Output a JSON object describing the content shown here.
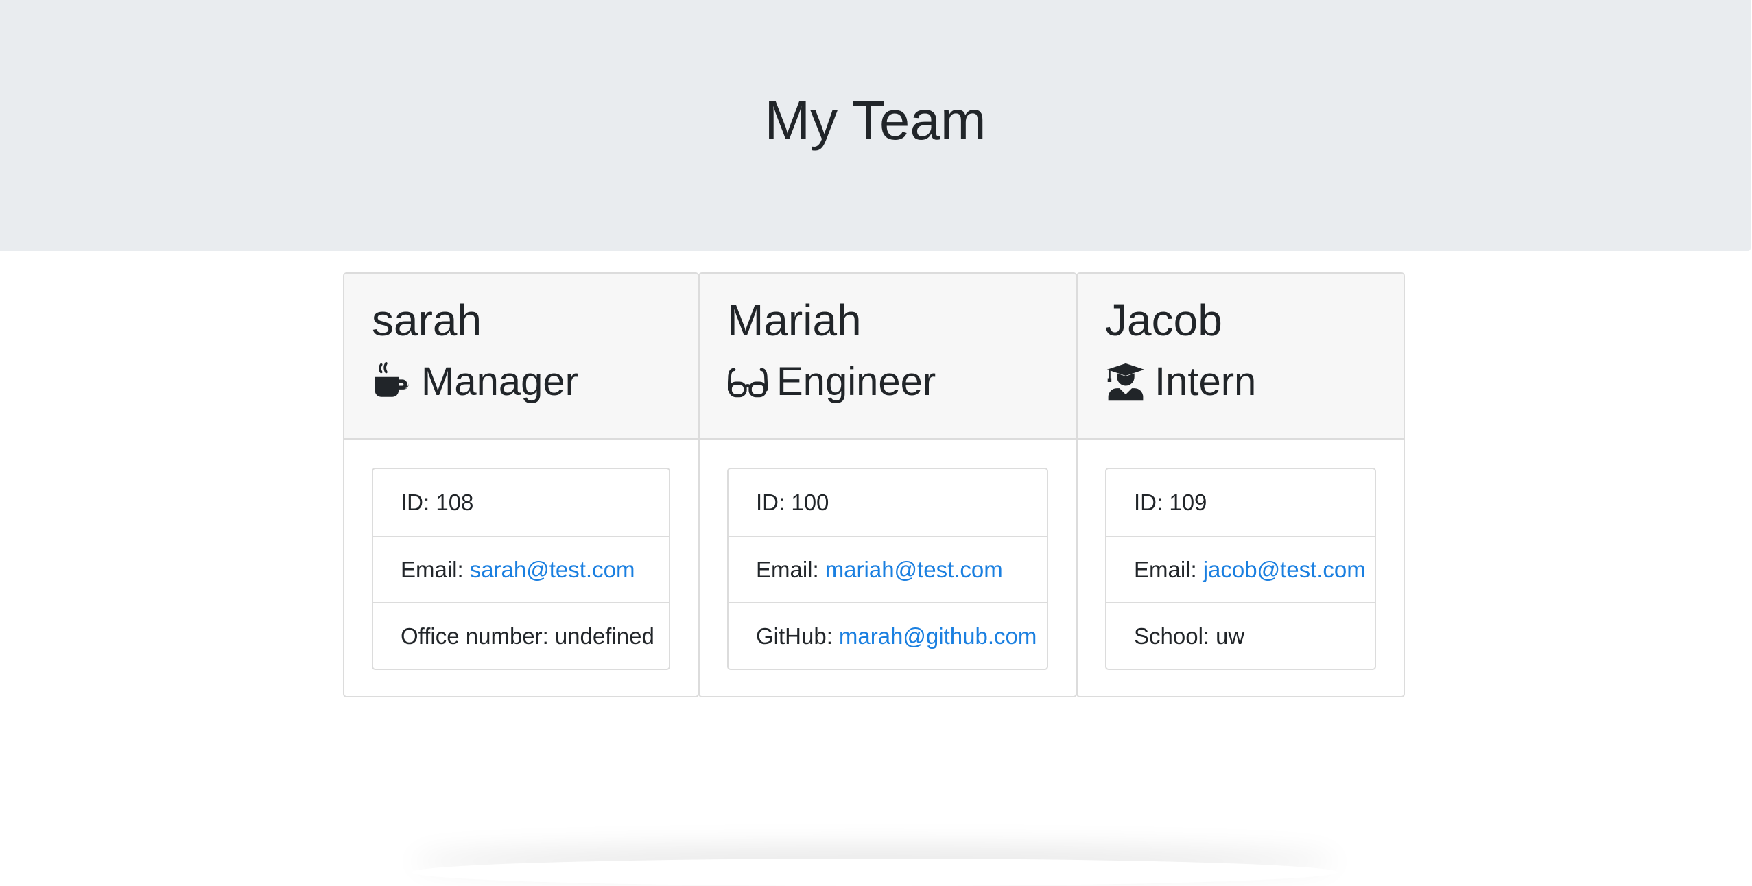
{
  "header": {
    "title": "My Team"
  },
  "cards": [
    {
      "name": "sarah",
      "role": "Manager",
      "role_icon": "coffee-mug-icon",
      "id_text": "ID: 108",
      "email_label": "Email:",
      "email": "sarah@test.com",
      "extra_label": "Office number:",
      "extra_value": "undefined"
    },
    {
      "name": "Mariah",
      "role": "Engineer",
      "role_icon": "glasses-icon",
      "id_text": "ID: 100",
      "email_label": "Email:",
      "email": "mariah@test.com",
      "extra_label": "GitHub:",
      "extra_value": "marah@github.com"
    },
    {
      "name": "Jacob",
      "role": "Intern",
      "role_icon": "graduate-icon",
      "id_text": "ID: 109",
      "email_label": "Email:",
      "email": "jacob@test.com",
      "extra_label": "School:",
      "extra_value": "uw"
    }
  ],
  "colors": {
    "jumbotron_bg": "#e9ecef",
    "card_header_bg": "#f7f7f7",
    "link": "#1a7fe0",
    "text": "#212529",
    "border": "#dcdcdc"
  }
}
